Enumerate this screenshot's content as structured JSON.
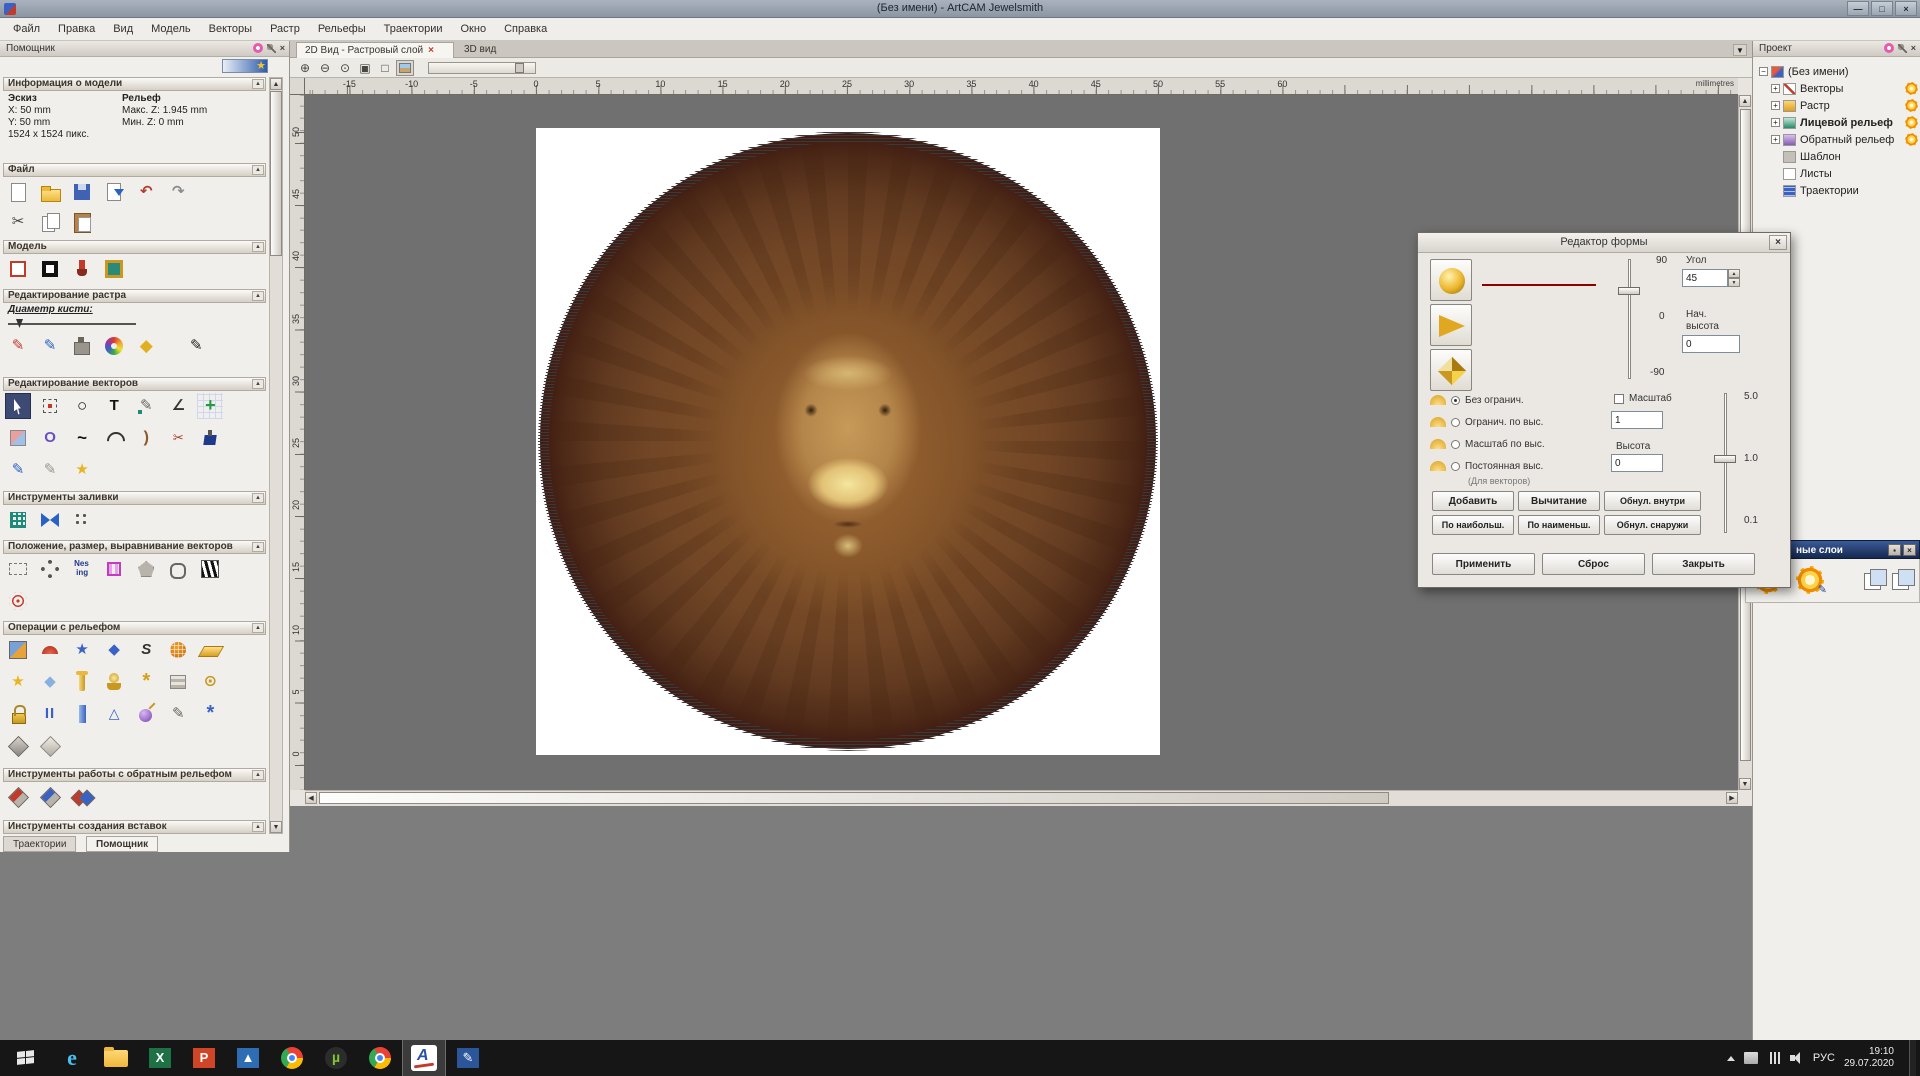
{
  "titlebar": {
    "title": "(Без имени) - ArtCAM Jewelsmith"
  },
  "menubar": {
    "items": [
      "Файл",
      "Правка",
      "Вид",
      "Модель",
      "Векторы",
      "Растр",
      "Рельефы",
      "Траектории",
      "Окно",
      "Справка"
    ]
  },
  "assistant": {
    "title": "Помощник",
    "model_info": {
      "header": "Информация о модели",
      "sketch_label": "Эскиз",
      "relief_label": "Рельеф",
      "x": "X: 50 mm",
      "y": "Y: 50 mm",
      "pixels": "1524 x 1524 пикс.",
      "max_z": "Макс. Z: 1.945 mm",
      "min_z": "Мин. Z: 0 mm"
    },
    "sections": {
      "file": "Файл",
      "model": "Модель",
      "raster": "Редактирование растра",
      "vectors": "Редактирование векторов",
      "fill": "Инструменты заливки",
      "position": "Положение, размер, выравнивание векторов",
      "relief": "Операции с рельефом",
      "back_relief": "Инструменты работы с обратным рельефом",
      "inlay": "Инструменты создания вставок"
    },
    "brush_diameter_label": "Диаметр кисти:",
    "bottom_tabs": {
      "toolpaths": "Траектории",
      "assistant": "Помощник"
    },
    "tool_icon_names": {
      "file": [
        "new-model-icon",
        "open-model-icon",
        "save-model-icon",
        "import-model-icon",
        "undo-icon",
        "redo-icon",
        "cut-icon",
        "copy-icon",
        "paste-icon"
      ],
      "model": [
        "set-model-size-icon",
        "invert-model-icon",
        "light-material-icon",
        "model-notes-icon"
      ],
      "raster": [
        "paint-icon",
        "draw-icon",
        "clone-icon",
        "colour-palette-icon",
        "flood-fill-icon",
        "pen-icon"
      ],
      "vectors": [
        "select-vectors-icon",
        "transform-vectors-icon",
        "create-circle-icon",
        "create-text-icon",
        "node-editing-icon",
        "measure-icon",
        "snap-grid-icon",
        "vector-doctor-icon",
        "offset-vector-icon",
        "create-polyline-icon",
        "create-arc-icon",
        "fit-arcs-icon",
        "trim-vectors-icon",
        "weld-vectors-icon",
        "free-polyline-icon",
        "smooth-polyline-icon",
        "create-star-icon"
      ],
      "fill": [
        "fill-grid-icon",
        "fill-crosshatch-icon",
        "fill-points-icon"
      ],
      "position": [
        "paste-along-curve-icon",
        "circular-copy-icon",
        "nesting-icon",
        "block-copy-icon",
        "polygon-copy-icon",
        "mirror-vectors-icon",
        "wrap-vectors-icon",
        "spiral-copy-icon"
      ],
      "relief": [
        "shape-editor-icon",
        "smooth-dome-icon",
        "star-relief-icon",
        "pyramid-relief-icon",
        "smooth-relief-icon",
        "weave-wizard-icon",
        "zero-plane-icon",
        "star-wizard-icon",
        "fade-relief-icon",
        "turn-wizard-icon",
        "emboss-wizard-icon",
        "axial-relief-icon",
        "subtract-relief-icon",
        "spin-relief-icon",
        "lock-relief-icon",
        "scale-relief-icon",
        "column-wizard-icon",
        "wireframe-relief-icon",
        "interactive-sculpting-icon",
        "slope-relief-icon",
        "crystallate-icon",
        "offset-relief-icon",
        "reset-relief-icon"
      ],
      "back_relief": [
        "mirror-back-relief-icon",
        "copy-back-relief-icon",
        "swap-back-relief-icon"
      ]
    }
  },
  "viewport": {
    "tab_2d": "2D Вид - Растровый слой",
    "tab_3d": "3D вид",
    "units_label": "millimetres",
    "h_ticks": [
      "-15",
      "-10",
      "-5",
      "0",
      "5",
      "10",
      "15",
      "20",
      "25",
      "30",
      "35",
      "40",
      "45",
      "50",
      "55",
      "60"
    ],
    "v_ticks": [
      "50",
      "45",
      "40",
      "35",
      "30",
      "25",
      "20",
      "15",
      "10",
      "5",
      "0"
    ],
    "toolbar_icon_names": [
      "zoom-in-icon",
      "zoom-out-icon",
      "zoom-previous-icon",
      "zoom-fit-icon",
      "zoom-window-icon",
      "layer-preview-toggle-icon",
      "opacity-slider"
    ]
  },
  "shape_editor": {
    "title": "Редактор формы",
    "angle": {
      "label": "Угол",
      "value": "45",
      "tick_top": "90",
      "tick_mid": "0",
      "tick_bottom": "-90"
    },
    "start_height": {
      "label_line1": "Нач.",
      "label_line2": "высота",
      "value": "0"
    },
    "options": [
      {
        "label": "Без огранич."
      },
      {
        "label": "Огранич. по выс."
      },
      {
        "label": "Масштаб по выс."
      },
      {
        "label": "Постоянная выс."
      }
    ],
    "options_note": "(Для векторов)",
    "scale": {
      "label": "Масштаб",
      "value": "1"
    },
    "height": {
      "label": "Высота",
      "value": "0"
    },
    "scale_slider": {
      "tick_top": "5.0",
      "tick_mid": "1.0",
      "tick_bottom": "0.1"
    },
    "buttons": {
      "add": "Добавить",
      "subtract": "Вычитание",
      "zero_inside": "Обнул. внутри",
      "merge_highest": "По наибольш.",
      "merge_lowest": "По наименьш.",
      "zero_outside": "Обнул. снаружи",
      "apply": "Применить",
      "reset": "Сброс",
      "close": "Закрыть"
    }
  },
  "project": {
    "title": "Проект",
    "tree": [
      {
        "label": "(Без имени)",
        "expander": "minus",
        "bold": false,
        "sun": false,
        "icon": "project-root-icon",
        "indent": 0
      },
      {
        "label": "Векторы",
        "expander": "plus",
        "bold": false,
        "sun": true,
        "icon": "vectors-node-icon",
        "indent": 1
      },
      {
        "label": "Растр",
        "expander": "plus",
        "bold": false,
        "sun": true,
        "icon": "raster-node-icon",
        "indent": 1
      },
      {
        "label": "Лицевой рельеф",
        "expander": "plus",
        "bold": true,
        "sun": true,
        "icon": "front-relief-node-icon",
        "indent": 1
      },
      {
        "label": "Обратный рельеф",
        "expander": "plus",
        "bold": false,
        "sun": true,
        "icon": "back-relief-node-icon",
        "indent": 1
      },
      {
        "label": "Шаблон",
        "expander": "none",
        "bold": false,
        "sun": false,
        "icon": "template-node-icon",
        "indent": 1
      },
      {
        "label": "Листы",
        "expander": "none",
        "bold": false,
        "sun": false,
        "icon": "sheets-node-icon",
        "indent": 1
      },
      {
        "label": "Траектории",
        "expander": "none",
        "bold": false,
        "sun": false,
        "icon": "toolpaths-node-icon",
        "indent": 1
      }
    ],
    "layers_panel_title": "ные слои"
  },
  "taskbar": {
    "lang": "РУС",
    "time": "19:10",
    "date": "29.07.2020",
    "icon_names": [
      "start-button",
      "ie-icon",
      "explorer-folder-icon",
      "excel-icon",
      "powerpoint-icon",
      "photos-icon",
      "chrome-icon",
      "utorrent-icon",
      "browser2-icon",
      "artcam-taskbar-icon",
      "editor-icon"
    ]
  }
}
